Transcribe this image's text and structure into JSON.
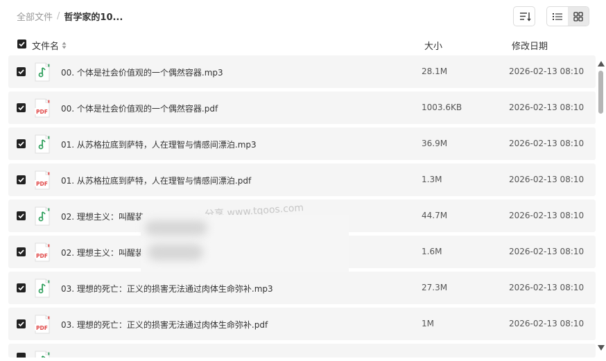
{
  "breadcrumb": {
    "root": "全部文件",
    "separator": "/",
    "current": "哲学家的10..."
  },
  "toolbar": {
    "sort_icon": "sort-lines-icon",
    "list_icon": "list-view-icon",
    "grid_icon": "grid-view-icon"
  },
  "header": {
    "name": "文件名",
    "size": "大小",
    "date": "修改日期"
  },
  "colors": {
    "audio_icon": "#2e9e5b",
    "pdf_icon": "#e04545",
    "row_bg": "#f5f5f5"
  },
  "files": [
    {
      "name": "00. 个体是社会价值观的一个偶然容器.mp3",
      "size": "28.1M",
      "date": "2026-02-13 08:10",
      "type": "audio"
    },
    {
      "name": "00. 个体是社会价值观的一个偶然容器.pdf",
      "size": "1003.6KB",
      "date": "2026-02-13 08:10",
      "type": "pdf"
    },
    {
      "name": "01. 从苏格拉底到萨特，人在理智与情感间漂泊.mp3",
      "size": "36.9M",
      "date": "2026-02-13 08:10",
      "type": "audio"
    },
    {
      "name": "01. 从苏格拉底到萨特，人在理智与情感间漂泊.pdf",
      "size": "1.3M",
      "date": "2026-02-13 08:10",
      "type": "pdf"
    },
    {
      "name": "02. 理想主义：叫醒装",
      "size": "44.7M",
      "date": "2026-02-13 08:10",
      "type": "audio"
    },
    {
      "name": "02. 理想主义：叫醒装",
      "size": "1.6M",
      "date": "2026-02-13 08:10",
      "type": "pdf"
    },
    {
      "name": "03. 理想的死亡：正义的损害无法通过肉体生命弥补.mp3",
      "size": "27.3M",
      "date": "2026-02-13 08:10",
      "type": "audio"
    },
    {
      "name": "03. 理想的死亡：正义的损害无法通过肉体生命弥补.pdf",
      "size": "1M",
      "date": "2026-02-13 08:10",
      "type": "pdf"
    }
  ],
  "watermark": "分享 www.tqoos.com"
}
